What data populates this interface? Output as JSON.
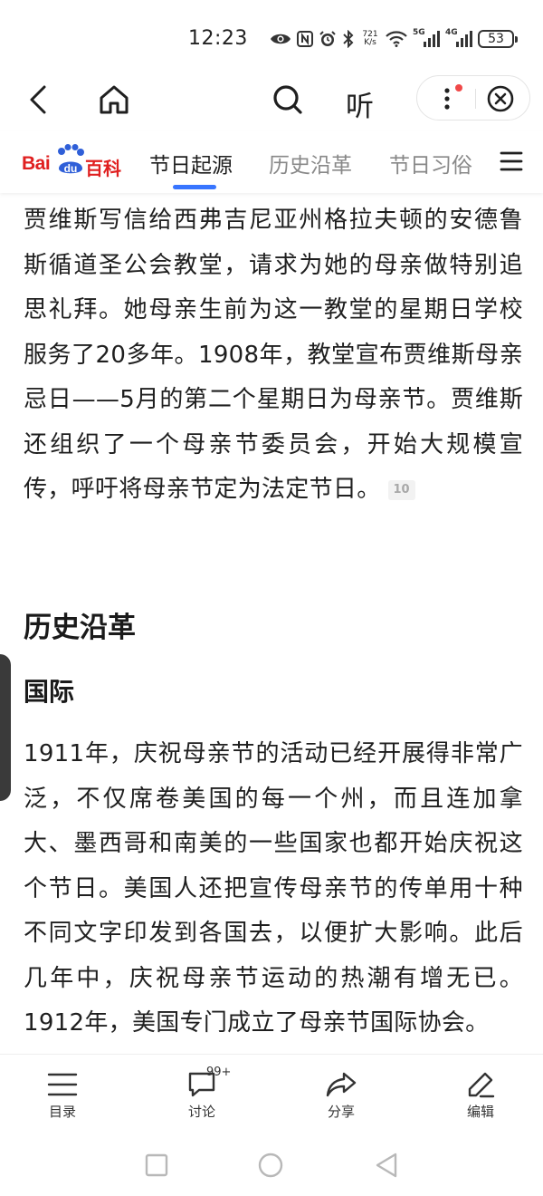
{
  "status_bar": {
    "time": "12:23",
    "net_speed_value": "721",
    "net_speed_unit": "K/s",
    "signal_1": "5G",
    "signal_2": "4G",
    "battery": "53",
    "icons": [
      "eye-icon",
      "nfc-icon",
      "alarm-icon",
      "bluetooth-icon",
      "wifi-icon",
      "signal-icon",
      "battery-icon"
    ]
  },
  "top_nav": {
    "back_icon": "back-arrow-icon",
    "home_icon": "home-icon",
    "search_icon": "search-icon",
    "listen_label": "听",
    "more_icon": "more-dots-icon",
    "close_icon": "close-circle-icon"
  },
  "tab_bar": {
    "logo": {
      "bai": "Bai",
      "du": "du",
      "baike": "百科"
    },
    "tabs": [
      {
        "label": "节日起源",
        "active": true
      },
      {
        "label": "历史沿革",
        "active": false
      },
      {
        "label": "节日习俗",
        "active": false
      }
    ],
    "menu_icon": "hamburger-menu-icon",
    "accent_color": "#3875ff",
    "brand_color": "#e02020"
  },
  "article": {
    "paragraph_1": "贾维斯写信给西弗吉尼亚州格拉夫顿的安德鲁斯循道圣公会教堂，请求为她的母亲做特别追思礼拜。她母亲生前为这一教堂的星期日学校服务了20多年。1908年，教堂宣布贾维斯母亲忌日——5月的第二个星期日为母亲节。贾维斯还组织了一个母亲节委员会，开始大规模宣传，呼吁将母亲节定为法定节日。",
    "reference_1": "10",
    "section_title": "历史沿革",
    "subsection_title": "国际",
    "paragraph_2": "1911年，庆祝母亲节的活动已经开展得非常广泛，不仅席卷美国的每一个州，而且连加拿大、墨西哥和南美的一些国家也都开始庆祝这个节日。美国人还把宣传母亲节的传单用十种不同文字印发到各国去，以便扩大影响。此后几年中，庆祝母亲节运动的热潮有增无已。1912年，美国专门成立了母亲节国际协会。"
  },
  "bottom_toolbar": {
    "items": [
      {
        "label": "目录",
        "icon": "catalog-icon"
      },
      {
        "label": "讨论",
        "icon": "comment-icon",
        "badge": "99+"
      },
      {
        "label": "分享",
        "icon": "share-icon"
      },
      {
        "label": "编辑",
        "icon": "edit-icon"
      }
    ]
  },
  "system_nav": {
    "icons": [
      "recents-square-icon",
      "home-circle-icon",
      "back-triangle-icon"
    ]
  }
}
